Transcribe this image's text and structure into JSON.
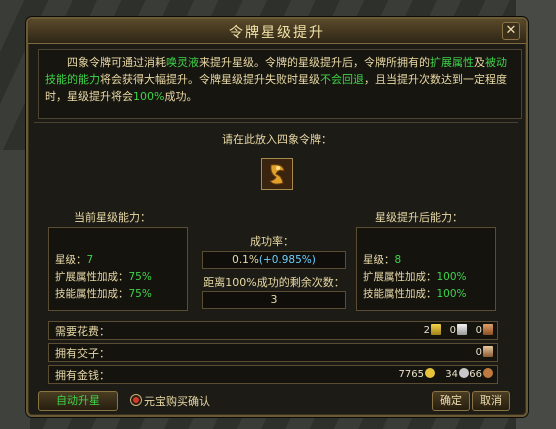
{
  "window": {
    "title": "令牌星级提升",
    "close_label": "✕"
  },
  "description": {
    "p1": "四象令牌可通过消耗",
    "p2": "唤灵液",
    "p3": "来提升星级。令牌的星级提升后，令牌所拥有的",
    "p4": "扩展属性",
    "p5": "及",
    "p6": "被动技能的能力",
    "p7": "将会获得大幅提升。令牌星级提升失败时星级",
    "p8": "不会回退",
    "p9": "，且当提升次数达到一定程度时，星级提升将会",
    "p10": "100%",
    "p11": "成功。"
  },
  "place_label": "请在此放入四象令牌：",
  "current": {
    "heading": "当前星级能力：",
    "star_label": "星级：",
    "star_value": "7",
    "ext_label": "扩展属性加成：",
    "ext_value": "75%",
    "skill_label": "技能属性加成：",
    "skill_value": "75%"
  },
  "after": {
    "heading": "星级提升后能力：",
    "star_label": "星级：",
    "star_value": "8",
    "ext_label": "扩展属性加成：",
    "ext_value": "100%",
    "skill_label": "技能属性加成：",
    "skill_value": "100%"
  },
  "success": {
    "label": "成功率：",
    "base": "0.1%",
    "bonus": "(+0.985%)"
  },
  "remaining": {
    "label": "距离100%成功的剩余次数：",
    "value": "3"
  },
  "costs": {
    "cost_label": "需要花费：",
    "cost_gold": "2",
    "cost_silver": "0",
    "cost_copper": "0",
    "jiaozi_label": "拥有交子：",
    "jiaozi_value": "0",
    "money_label": "拥有金钱：",
    "money_gold": "7765",
    "money_silver": "34",
    "money_copper": "66"
  },
  "colors": {
    "highlight_green": "#3fd44a",
    "bonus_blue": "#6ad0ff",
    "gold": "#f2d64a",
    "silver": "#c8c8c8",
    "copper": "#c07a3e"
  },
  "controls": {
    "auto_upgrade": "自动升星",
    "yuanbao_confirm": "元宝购买确认",
    "ok": "确定",
    "cancel": "取消"
  }
}
